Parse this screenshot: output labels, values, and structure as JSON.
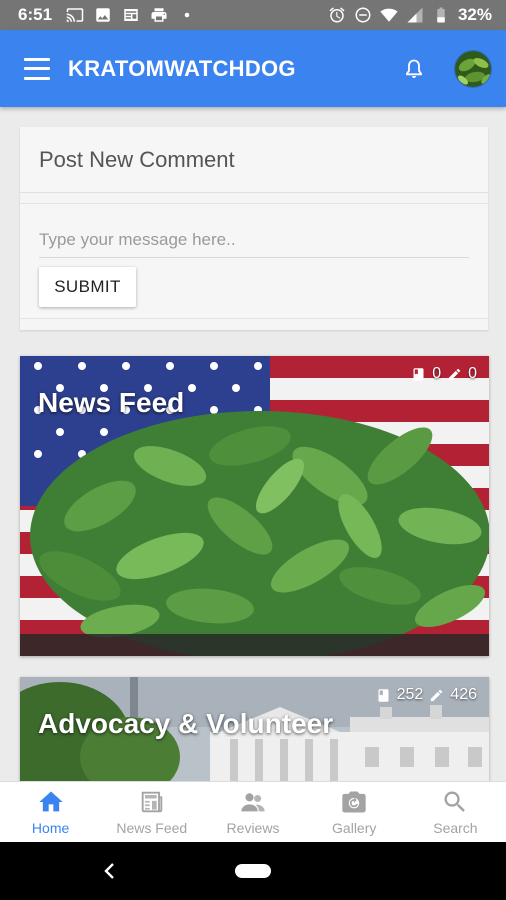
{
  "status_bar": {
    "time": "6:51",
    "battery": "32%",
    "icons": [
      "cast-icon",
      "image-icon",
      "news-icon",
      "print-icon",
      "dot-icon",
      "alarm-icon",
      "dnd-icon",
      "wifi-icon",
      "signal-icon",
      "battery-icon"
    ]
  },
  "app_bar": {
    "title": "KRATOMWATCHDOG",
    "icons": [
      "menu-icon",
      "bell-icon",
      "avatar"
    ]
  },
  "comment": {
    "header": "Post New Comment",
    "placeholder": "Type your message here..",
    "value": "",
    "submit_label": "SUBMIT"
  },
  "feed": [
    {
      "title": "News Feed",
      "posts": "0",
      "edits": "0"
    },
    {
      "title": "Advocacy & Volunteer",
      "posts": "252",
      "edits": "426"
    }
  ],
  "bottom_nav": [
    {
      "label": "Home",
      "icon": "home-icon",
      "active": true
    },
    {
      "label": "News Feed",
      "icon": "newspaper-icon",
      "active": false
    },
    {
      "label": "Reviews",
      "icon": "people-icon",
      "active": false
    },
    {
      "label": "Gallery",
      "icon": "camera-icon",
      "active": false
    },
    {
      "label": "Search",
      "icon": "search-icon",
      "active": false
    }
  ],
  "colors": {
    "accent": "#3b83ef",
    "status_bar": "#757575",
    "inactive_nav": "#a3a3a3"
  }
}
